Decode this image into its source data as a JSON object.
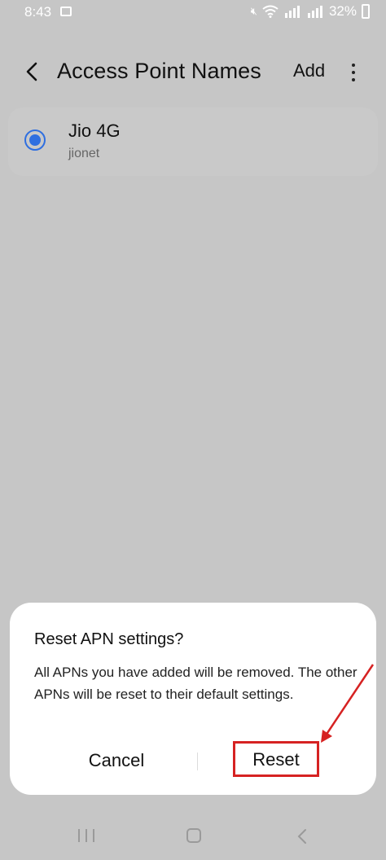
{
  "status_bar": {
    "time": "8:43",
    "battery": "32%",
    "icons": [
      "gallery-icon",
      "mute-icon",
      "wifi-icon",
      "volte-signal-icon",
      "volte-signal-icon",
      "battery-icon"
    ]
  },
  "app_bar": {
    "title": "Access Point Names",
    "add_label": "Add",
    "back_icon": "chevron-left-icon",
    "more_icon": "more-vertical-icon"
  },
  "apn_list": [
    {
      "name": "Jio 4G",
      "apn": "jionet",
      "selected": true
    }
  ],
  "dialog": {
    "title": "Reset APN settings?",
    "message": "All APNs you have added will be removed. The other APNs will be reset to their default settings.",
    "cancel_label": "Cancel",
    "reset_label": "Reset"
  },
  "annotation": {
    "color": "#d62222"
  },
  "colors": {
    "accent": "#2f6fe0",
    "dim_background": "#c6c6c6",
    "dialog_bg": "#ffffff"
  }
}
